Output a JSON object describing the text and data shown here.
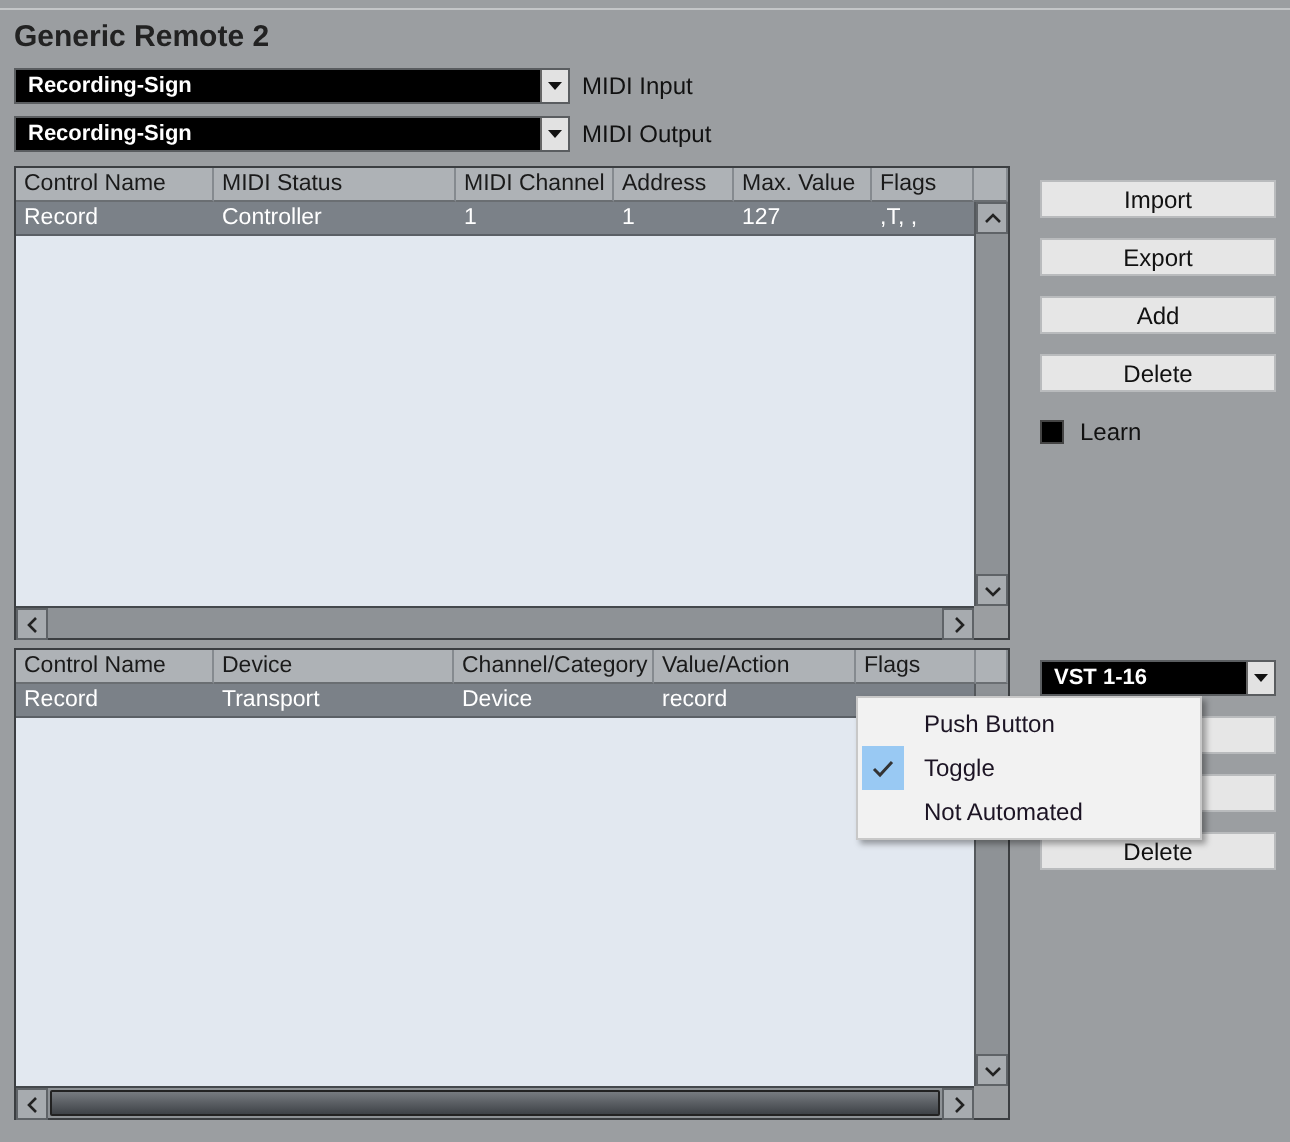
{
  "title": "Generic Remote 2",
  "midi_input": {
    "value": "Recording-Sign",
    "label": "MIDI Input"
  },
  "midi_output": {
    "value": "Recording-Sign",
    "label": "MIDI Output"
  },
  "top_table": {
    "columns": [
      "Control Name",
      "MIDI Status",
      "MIDI Channel",
      "Address",
      "Max. Value",
      "Flags"
    ],
    "rows": [
      {
        "cells": [
          "Record",
          "Controller",
          "1",
          "1",
          "127",
          ",T, ,"
        ],
        "selected": true
      }
    ]
  },
  "top_buttons": [
    "Import",
    "Export",
    "Add",
    "Delete"
  ],
  "learn": {
    "label": "Learn",
    "checked": false
  },
  "bottom_table": {
    "columns": [
      "Control Name",
      "Device",
      "Channel/Category",
      "Value/Action",
      "Flags"
    ],
    "rows": [
      {
        "cells": [
          "Record",
          "Transport",
          "Device",
          "record"
        ],
        "selected": true
      }
    ]
  },
  "bank_dropdown": {
    "value": "VST 1-16"
  },
  "bottom_buttons": [
    "Delete"
  ],
  "flags_menu": {
    "items": [
      {
        "label": "Push Button",
        "checked": false
      },
      {
        "label": "Toggle",
        "checked": true
      },
      {
        "label": "Not Automated",
        "checked": false
      }
    ]
  }
}
